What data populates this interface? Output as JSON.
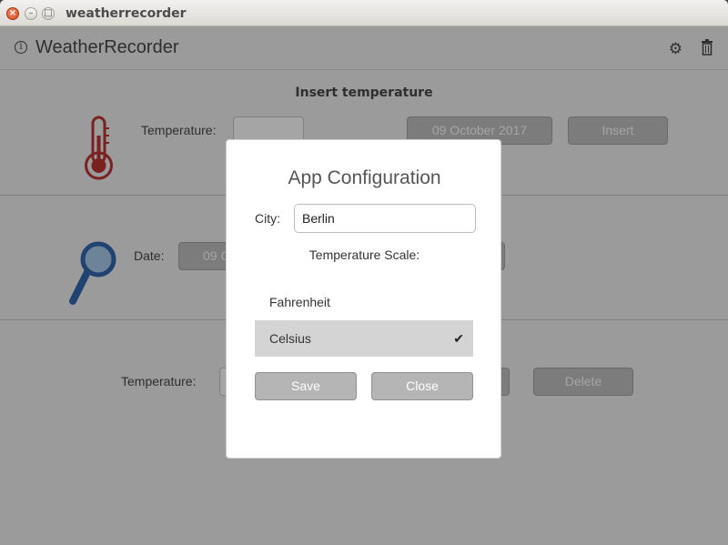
{
  "window": {
    "title": "weatherrecorder",
    "close_glyph": "×",
    "min_glyph": "–",
    "max_glyph": "□"
  },
  "appbar": {
    "title": "WeatherRecorder",
    "info_glyph": "i",
    "settings_glyph": "⚙"
  },
  "insert": {
    "title": "Insert temperature",
    "temperature_label": "Temperature:",
    "date_value": "09 October 2017",
    "insert_label": "Insert"
  },
  "search": {
    "date_label": "Date:",
    "date_value": "09 O"
  },
  "result": {
    "temperature_label": "Temperature:",
    "delete_label": "Delete"
  },
  "dialog": {
    "title": "App Configuration",
    "city_label": "City:",
    "city_value": "Berlin",
    "scale_label": "Temperature Scale:",
    "options": [
      "Fahrenheit",
      "Celsius"
    ],
    "selected": "Celsius",
    "check_glyph": "✔",
    "save_label": "Save",
    "close_label": "Close"
  },
  "colors": {
    "accent_red": "#b71c1c",
    "magnifier_blue": "#1a56a6",
    "selected_bg": "#d4d4d4"
  }
}
